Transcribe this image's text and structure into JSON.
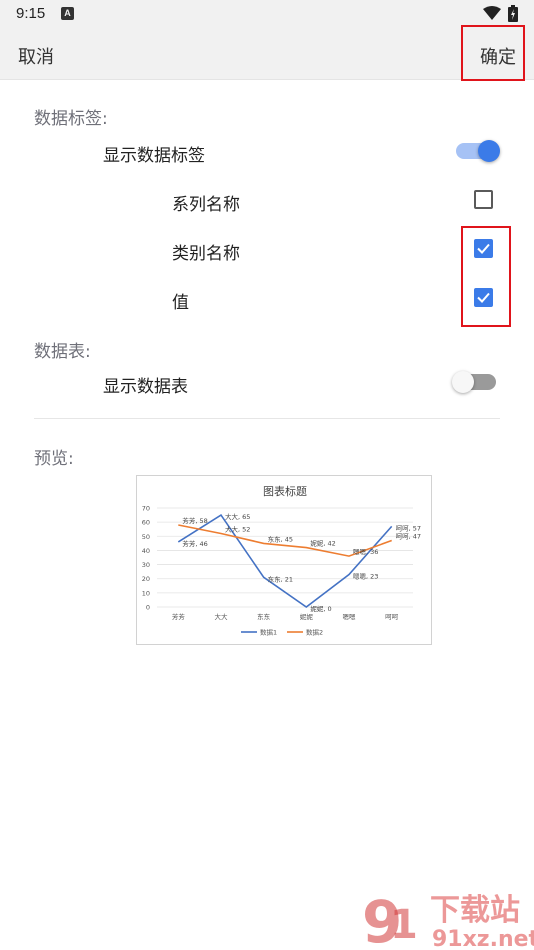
{
  "status_bar": {
    "time": "9:15",
    "a_badge": "A"
  },
  "top_bar": {
    "cancel_label": "取消",
    "confirm_label": "确定"
  },
  "data_labels_section": {
    "heading": "数据标签:",
    "show_label": "显示数据标签",
    "show_on": true,
    "options": [
      {
        "label": "系列名称",
        "checked": false
      },
      {
        "label": "类别名称",
        "checked": true
      },
      {
        "label": "值",
        "checked": true
      }
    ]
  },
  "data_table_section": {
    "heading": "数据表:",
    "show_label": "显示数据表",
    "show_on": false
  },
  "preview_section": {
    "heading": "预览:"
  },
  "chart_data": {
    "type": "line",
    "title": "图表标题",
    "categories": [
      "芳芳",
      "大大",
      "东东",
      "妮妮",
      "嗯嗯",
      "呵呵"
    ],
    "series": [
      {
        "name": "数据1",
        "values": [
          46,
          65,
          21,
          0,
          23,
          57
        ],
        "color": "#4472c4"
      },
      {
        "name": "数据2",
        "values": [
          58,
          52,
          45,
          42,
          36,
          47
        ],
        "color": "#ed7d31"
      }
    ],
    "ylim": [
      0,
      70
    ],
    "yticks": [
      0,
      10,
      20,
      30,
      40,
      50,
      60,
      70
    ],
    "grid": true,
    "legend": "bottom"
  },
  "watermark": {
    "big_text": "下载站",
    "url_text": "91xz.net"
  },
  "colors": {
    "accent": "#3b7be8",
    "highlight": "#e0141b"
  }
}
